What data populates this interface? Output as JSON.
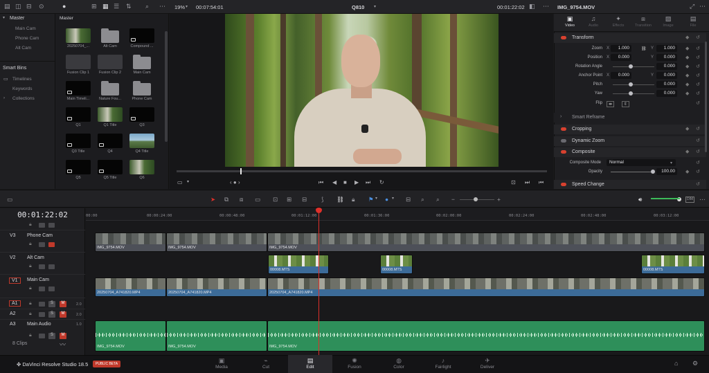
{
  "topbar": {
    "zoom": "19%",
    "source_timecode": "00:07:54:01",
    "viewer_title": "Q810",
    "record_timecode": "00:01:22:02",
    "clip_name": "IMG_9754.MOV"
  },
  "bins": {
    "master": "Master",
    "items": [
      "Main Cam",
      "Phone Cam",
      "Alt Cam"
    ],
    "smart_bins": "Smart Bins",
    "smart_items": [
      "Timelines",
      "Keywords",
      "Collections"
    ]
  },
  "media_pool": {
    "header": "Master",
    "clips": [
      {
        "label": "20250704_...",
        "kind": "forest"
      },
      {
        "label": "Alt Cam",
        "kind": "folder"
      },
      {
        "label": "Compound ...",
        "kind": "black"
      },
      {
        "label": "Fusion Clip 1",
        "kind": "dark"
      },
      {
        "label": "Fusion Clip 2",
        "kind": "dark"
      },
      {
        "label": "Main Cam",
        "kind": "folder"
      },
      {
        "label": "Main Timeli...",
        "kind": "black"
      },
      {
        "label": "Nature Fou...",
        "kind": "folder"
      },
      {
        "label": "Phone Cam",
        "kind": "folder"
      },
      {
        "label": "Q1",
        "kind": "black"
      },
      {
        "label": "Q1 Title",
        "kind": "forest"
      },
      {
        "label": "Q3",
        "kind": "black"
      },
      {
        "label": "Q3 Title",
        "kind": "black"
      },
      {
        "label": "Q4",
        "kind": "black"
      },
      {
        "label": "Q4 Title",
        "kind": "lake"
      },
      {
        "label": "Q5",
        "kind": "black"
      },
      {
        "label": "Q5 Title",
        "kind": "black"
      },
      {
        "label": "Q6",
        "kind": "forest"
      }
    ]
  },
  "inspector": {
    "tabs": [
      "Video",
      "Audio",
      "Effects",
      "Transition",
      "Image",
      "File"
    ],
    "transform": "Transform",
    "zoom_label": "Zoom",
    "zoom_x": "1.000",
    "zoom_y": "1.000",
    "position_label": "Position",
    "position_x": "0.000",
    "position_y": "0.000",
    "rotation_label": "Rotation Angle",
    "rotation": "0.000",
    "anchor_label": "Anchor Point",
    "anchor_x": "0.000",
    "anchor_y": "0.000",
    "pitch_label": "Pitch",
    "pitch": "0.000",
    "yaw_label": "Yaw",
    "yaw": "0.000",
    "flip_label": "Flip",
    "x": "X",
    "y": "Y",
    "smart_reframe": "Smart Reframe",
    "cropping": "Cropping",
    "dynamic_zoom": "Dynamic Zoom",
    "composite": "Composite",
    "composite_mode_label": "Composite Mode",
    "composite_mode": "Normal",
    "opacity_label": "Opacity",
    "opacity": "100.00",
    "speed_change": "Speed Change"
  },
  "timeline": {
    "timecode": "00:01:22:02",
    "ruler": [
      "00:00",
      "00:00:24:00",
      "00:00:48:00",
      "00:01:12:00",
      "00:01:36:00",
      "00:02:00:00",
      "00:02:24:00",
      "00:02:48:00",
      "00:03:12:00"
    ],
    "tracks": {
      "v3": {
        "id": "V3",
        "name": "Phone Cam"
      },
      "v2": {
        "id": "V2",
        "name": "Alt Cam"
      },
      "v1": {
        "id": "V1",
        "name": "Main Cam"
      },
      "a1": {
        "id": "A1",
        "level": "2.0"
      },
      "a2": {
        "id": "A2",
        "level": "2.0"
      },
      "a3": {
        "id": "A3",
        "name": "Main Audio",
        "level": "1.0",
        "clips": "8 Clips"
      }
    },
    "clip_labels": {
      "phone": "IMG_9754.MOV",
      "alt": "00008.MTS",
      "main": "20250704_A741820.MP4",
      "audio": "IMG_9754.MOV"
    },
    "mute": "M",
    "solo": "S"
  },
  "pages": [
    "Media",
    "Cut",
    "Edit",
    "Fusion",
    "Color",
    "Fairlight",
    "Deliver"
  ],
  "active_page": "Edit",
  "brand": "DaVinci Resolve Studio 18.5",
  "beta": "PUBLIC BETA"
}
